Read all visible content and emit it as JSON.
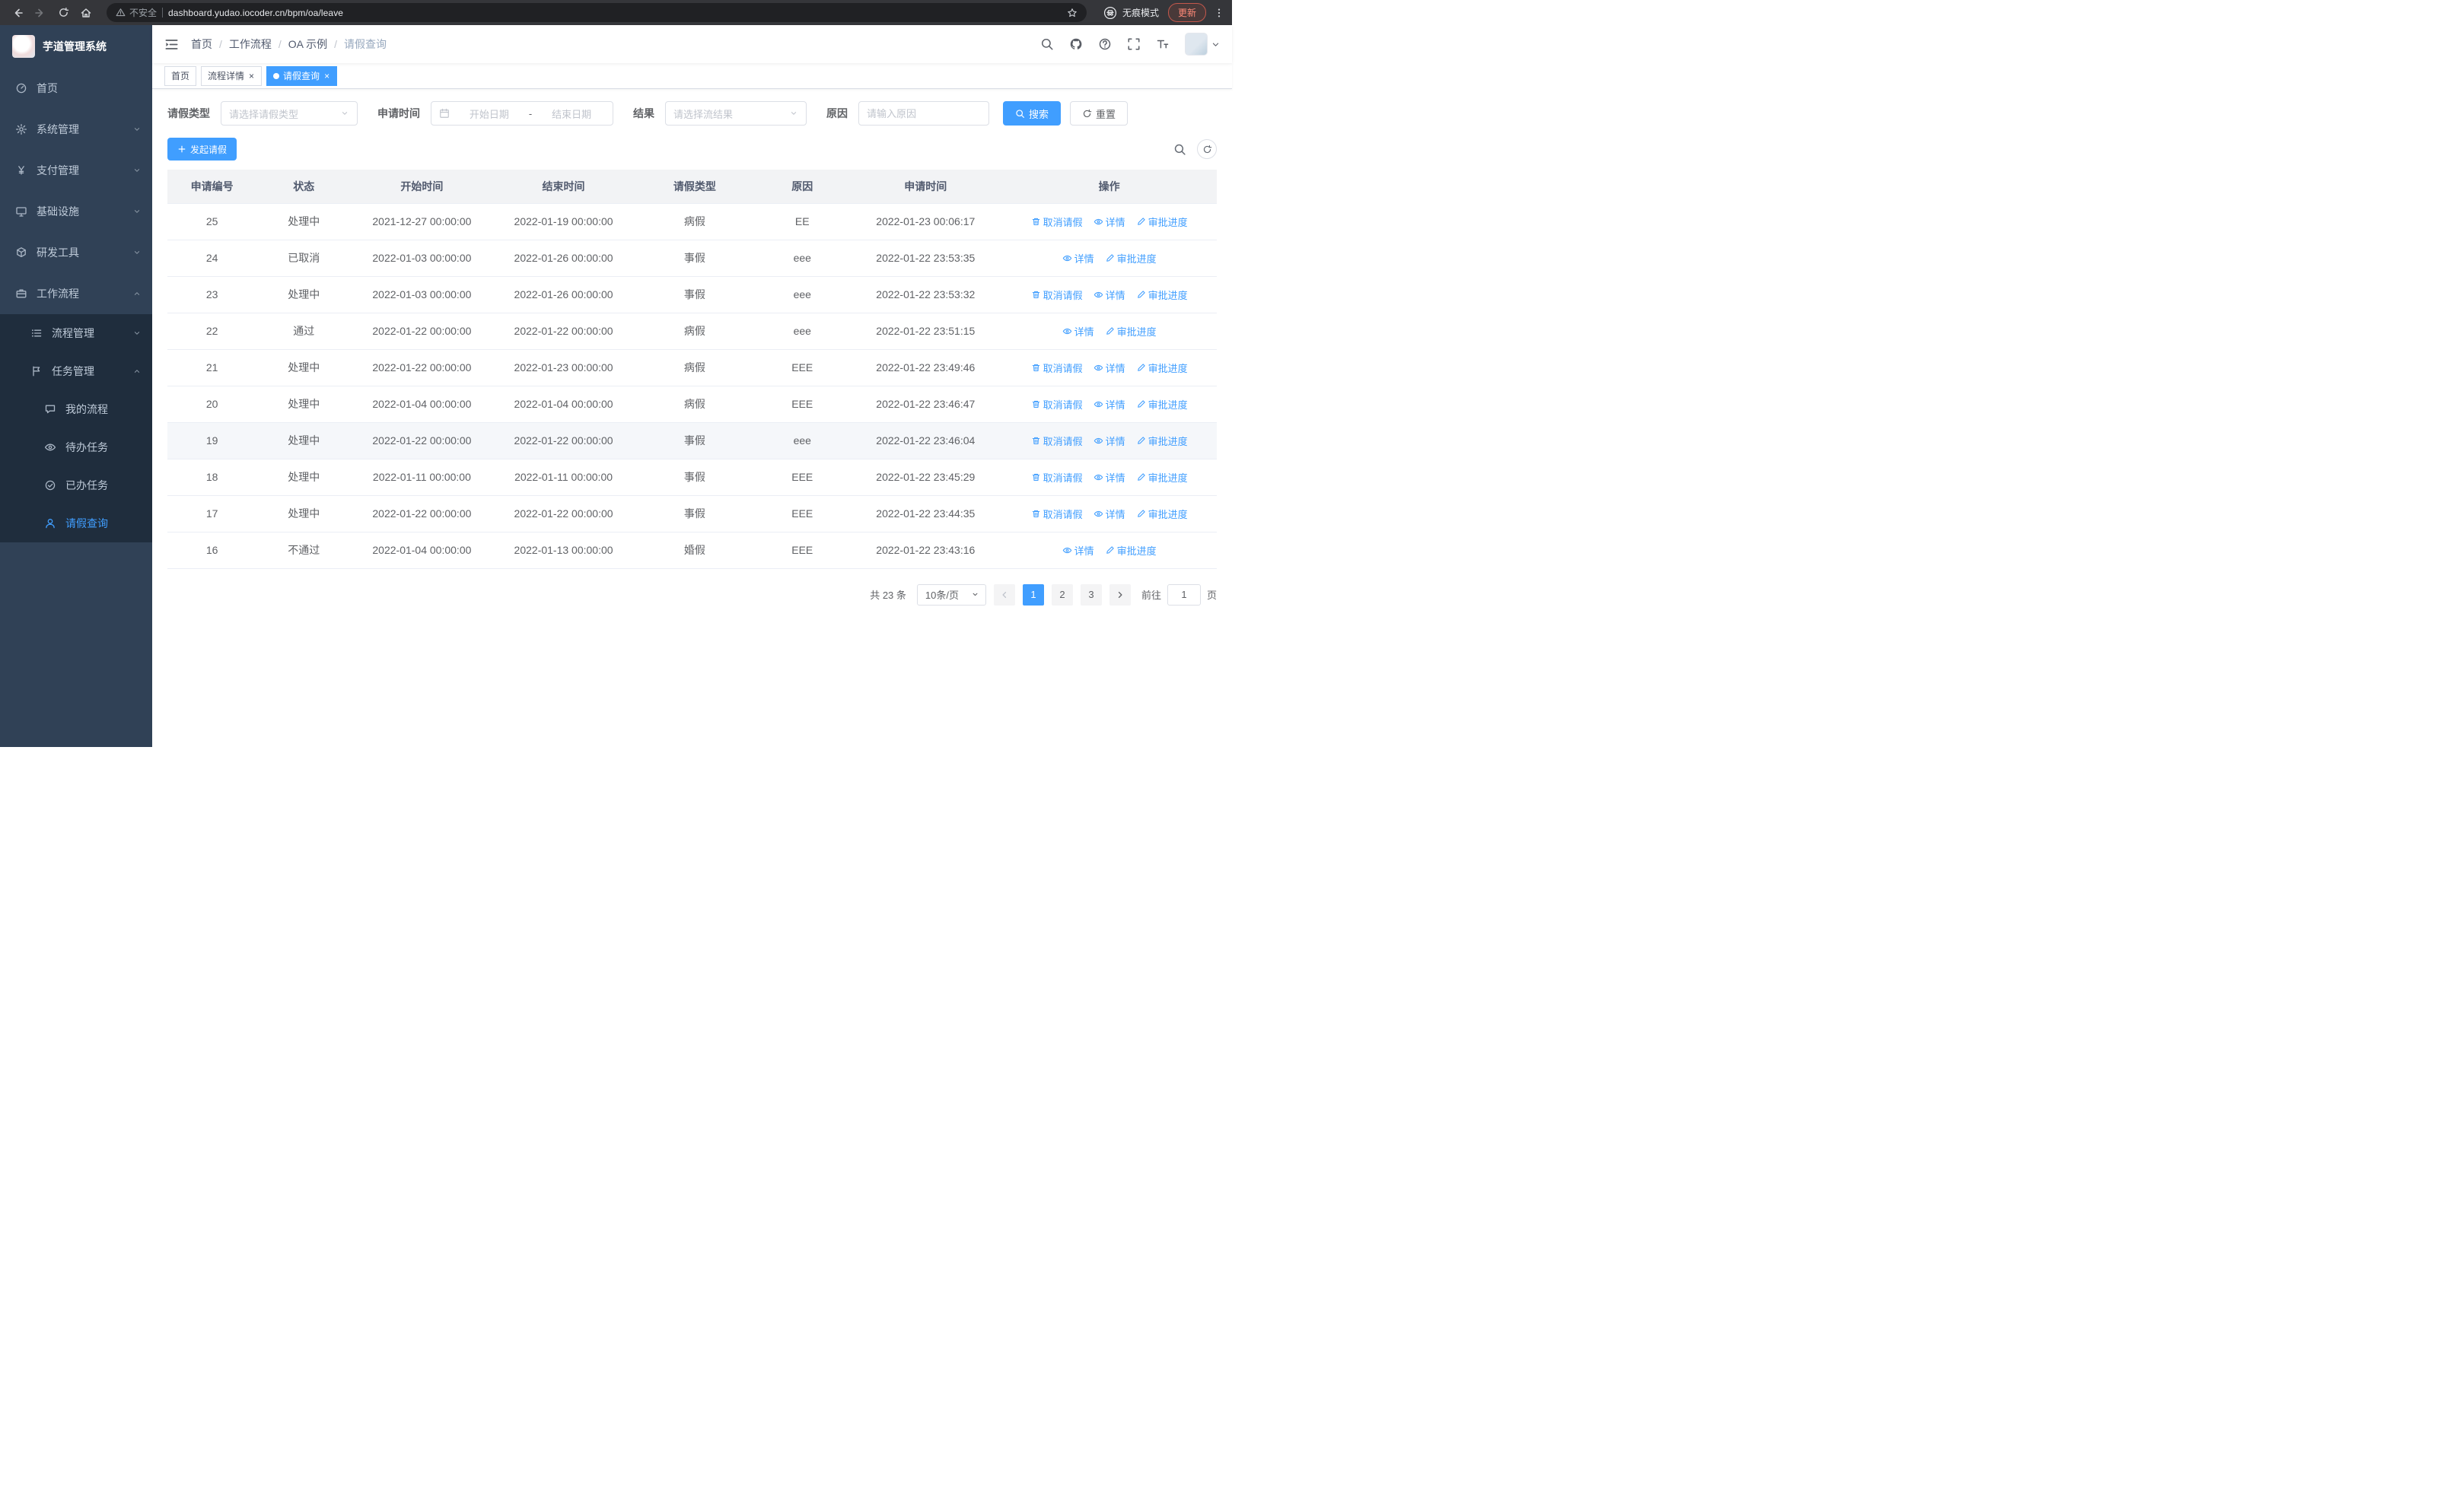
{
  "browser": {
    "security_label": "不安全",
    "url": "dashboard.yudao.iocoder.cn/bpm/oa/leave",
    "incognito_label": "无痕模式",
    "update_label": "更新"
  },
  "sidebar": {
    "logo_title": "芋道管理系统",
    "items": [
      {
        "label": "首页",
        "icon": "dashboard",
        "depth": 1
      },
      {
        "label": "系统管理",
        "icon": "gear",
        "depth": 1,
        "chevron": "down"
      },
      {
        "label": "支付管理",
        "icon": "yen",
        "depth": 1,
        "chevron": "down"
      },
      {
        "label": "基础设施",
        "icon": "infra",
        "depth": 1,
        "chevron": "down"
      },
      {
        "label": "研发工具",
        "icon": "tools",
        "depth": 1,
        "chevron": "down"
      },
      {
        "label": "工作流程",
        "icon": "briefcase",
        "depth": 1,
        "chevron": "up"
      },
      {
        "label": "流程管理",
        "icon": "list",
        "depth": 2,
        "chevron": "down",
        "submenu": true
      },
      {
        "label": "任务管理",
        "icon": "flag",
        "depth": 2,
        "chevron": "up",
        "submenu": true
      },
      {
        "label": "我的流程",
        "icon": "chat",
        "depth": 3,
        "submenu": true
      },
      {
        "label": "待办任务",
        "icon": "eye",
        "depth": 3,
        "submenu": true
      },
      {
        "label": "已办任务",
        "icon": "check",
        "depth": 3,
        "submenu": true
      },
      {
        "label": "请假查询",
        "icon": "user",
        "depth": 3,
        "submenu": true,
        "active": true
      }
    ]
  },
  "header": {
    "breadcrumb": [
      "首页",
      "工作流程",
      "OA 示例",
      "请假查询"
    ],
    "icons": [
      "search",
      "github",
      "question",
      "fullscreen",
      "fontsize"
    ]
  },
  "tabs": [
    {
      "label": "首页",
      "closable": false,
      "active": false
    },
    {
      "label": "流程详情",
      "closable": true,
      "active": false
    },
    {
      "label": "请假查询",
      "closable": true,
      "active": true
    }
  ],
  "filters": {
    "leave_type_label": "请假类型",
    "leave_type_placeholder": "请选择请假类型",
    "apply_time_label": "申请时间",
    "start_date_placeholder": "开始日期",
    "date_separator": "-",
    "end_date_placeholder": "结束日期",
    "result_label": "结果",
    "result_placeholder": "请选择流结果",
    "reason_label": "原因",
    "reason_placeholder": "请输入原因",
    "search_label": "搜索",
    "reset_label": "重置"
  },
  "toolbar": {
    "create_label": "发起请假"
  },
  "table": {
    "columns": [
      "申请编号",
      "状态",
      "开始时间",
      "结束时间",
      "请假类型",
      "原因",
      "申请时间",
      "操作"
    ],
    "ops": {
      "cancel": {
        "label": "取消请假",
        "icon": "trash"
      },
      "detail": {
        "label": "详情",
        "icon": "eye"
      },
      "progress": {
        "label": "审批进度",
        "icon": "pen"
      }
    },
    "rows": [
      {
        "id": "25",
        "status": "处理中",
        "start": "2021-12-27 00:00:00",
        "end": "2022-01-19 00:00:00",
        "type": "病假",
        "reason": "EE",
        "applied": "2022-01-23 00:06:17",
        "cancelable": true,
        "highlighted": false
      },
      {
        "id": "24",
        "status": "已取消",
        "start": "2022-01-03 00:00:00",
        "end": "2022-01-26 00:00:00",
        "type": "事假",
        "reason": "eee",
        "applied": "2022-01-22 23:53:35",
        "cancelable": false,
        "highlighted": false
      },
      {
        "id": "23",
        "status": "处理中",
        "start": "2022-01-03 00:00:00",
        "end": "2022-01-26 00:00:00",
        "type": "事假",
        "reason": "eee",
        "applied": "2022-01-22 23:53:32",
        "cancelable": true,
        "highlighted": false
      },
      {
        "id": "22",
        "status": "通过",
        "start": "2022-01-22 00:00:00",
        "end": "2022-01-22 00:00:00",
        "type": "病假",
        "reason": "eee",
        "applied": "2022-01-22 23:51:15",
        "cancelable": false,
        "highlighted": false
      },
      {
        "id": "21",
        "status": "处理中",
        "start": "2022-01-22 00:00:00",
        "end": "2022-01-23 00:00:00",
        "type": "病假",
        "reason": "EEE",
        "applied": "2022-01-22 23:49:46",
        "cancelable": true,
        "highlighted": false
      },
      {
        "id": "20",
        "status": "处理中",
        "start": "2022-01-04 00:00:00",
        "end": "2022-01-04 00:00:00",
        "type": "病假",
        "reason": "EEE",
        "applied": "2022-01-22 23:46:47",
        "cancelable": true,
        "highlighted": false
      },
      {
        "id": "19",
        "status": "处理中",
        "start": "2022-01-22 00:00:00",
        "end": "2022-01-22 00:00:00",
        "type": "事假",
        "reason": "eee",
        "applied": "2022-01-22 23:46:04",
        "cancelable": true,
        "highlighted": true
      },
      {
        "id": "18",
        "status": "处理中",
        "start": "2022-01-11 00:00:00",
        "end": "2022-01-11 00:00:00",
        "type": "事假",
        "reason": "EEE",
        "applied": "2022-01-22 23:45:29",
        "cancelable": true,
        "highlighted": false
      },
      {
        "id": "17",
        "status": "处理中",
        "start": "2022-01-22 00:00:00",
        "end": "2022-01-22 00:00:00",
        "type": "事假",
        "reason": "EEE",
        "applied": "2022-01-22 23:44:35",
        "cancelable": true,
        "highlighted": false
      },
      {
        "id": "16",
        "status": "不通过",
        "start": "2022-01-04 00:00:00",
        "end": "2022-01-13 00:00:00",
        "type": "婚假",
        "reason": "EEE",
        "applied": "2022-01-22 23:43:16",
        "cancelable": false,
        "highlighted": false
      }
    ]
  },
  "pagination": {
    "total_text": "共 23 条",
    "page_size_text": "10条/页",
    "pages": [
      "1",
      "2",
      "3"
    ],
    "active_page": "1",
    "goto_prefix": "前往",
    "goto_value": "1",
    "goto_suffix": "页"
  }
}
